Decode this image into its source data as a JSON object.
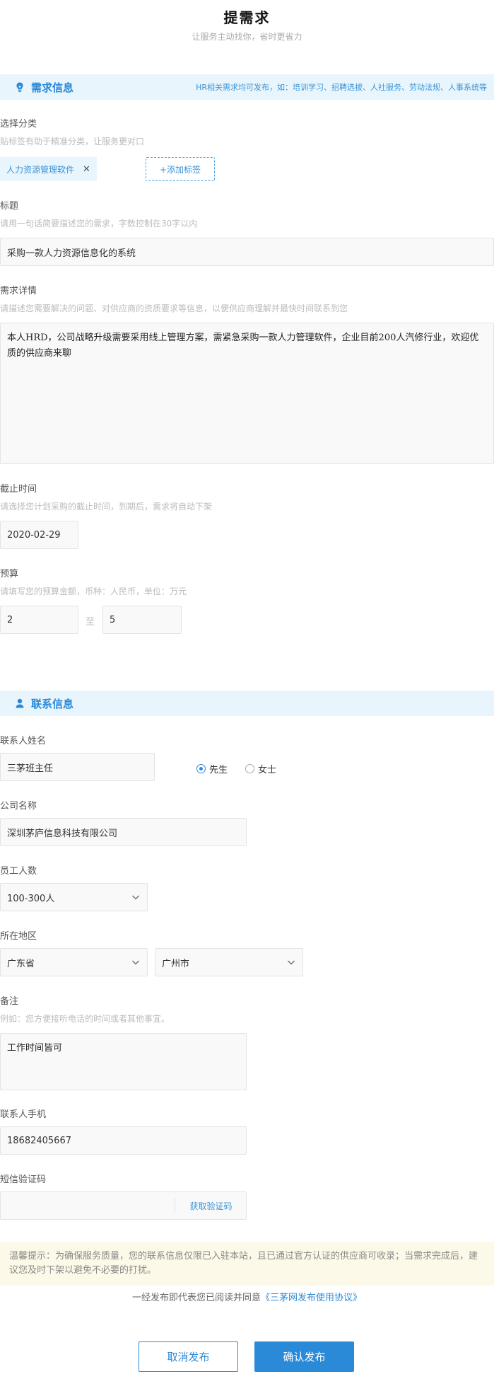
{
  "page": {
    "title": "提需求",
    "subtitle": "让服务主动找你，省时更省力"
  },
  "demand_section": {
    "title": "需求信息",
    "note": "HR相关需求均可发布，如：培训学习、招聘选拔、人社服务、劳动法规、人事系统等",
    "icon": "lightbulb-icon"
  },
  "category": {
    "label": "选择分类",
    "hint": "贴标签有助于精准分类，让服务更对口",
    "tag": "人力资源管理软件",
    "add_tag": "+添加标签"
  },
  "title_field": {
    "label": "标题",
    "hint": "请用一句话简要描述您的需求，字数控制在30字以内",
    "value": "采购一款人力资源信息化的系统"
  },
  "detail_field": {
    "label": "需求详情",
    "hint": "请描述您需要解决的问题、对供应商的资质要求等信息，以便供应商理解并最快时间联系到您",
    "value": "本人HRD，公司战略升级需要采用线上管理方案，需紧急采购一款人力管理软件，企业目前200人汽修行业，欢迎优质的供应商来聊"
  },
  "deadline_field": {
    "label": "截止时间",
    "hint": "请选择您计划采购的截止时间，到期后，需求将自动下架",
    "value": "2020-02-29"
  },
  "budget_field": {
    "label": "预算",
    "hint": "请填写您的预算金额，币种：人民币，单位：万元",
    "min": "2",
    "separator": "至",
    "max": "5"
  },
  "contact_section": {
    "title": "联系信息",
    "icon": "person-icon"
  },
  "contact_name": {
    "label": "联系人姓名",
    "value": "三茅班主任",
    "gender_options": [
      "先生",
      "女士"
    ],
    "gender_selected": "先生"
  },
  "company": {
    "label": "公司名称",
    "value": "深圳茅庐信息科技有限公司"
  },
  "employees": {
    "label": "员工人数",
    "value": "100-300人"
  },
  "region": {
    "label": "所在地区",
    "province": "广东省",
    "city": "广州市"
  },
  "remark": {
    "label": "备注",
    "hint": "例如：您方便接听电话的时间或者其他事宜。",
    "value": "工作时间皆可"
  },
  "phone": {
    "label": "联系人手机",
    "value": "18682405667"
  },
  "sms": {
    "label": "短信验证码",
    "value": "",
    "get_code": "获取验证码"
  },
  "tip": "温馨提示：为确保服务质量，您的联系信息仅限已入驻本站，且已通过官方认证的供应商可收录；当需求完成后，建议您及时下架以避免不必要的打扰。",
  "agreement": {
    "text": "一经发布即代表您已阅读并同意",
    "link": "《三茅网发布使用协议》"
  },
  "actions": {
    "cancel": "取消发布",
    "confirm": "确认发布"
  },
  "colors": {
    "accent": "#2b8ad8",
    "section_bg": "#e9f5fc",
    "tip_bg": "#fdf9e8"
  }
}
